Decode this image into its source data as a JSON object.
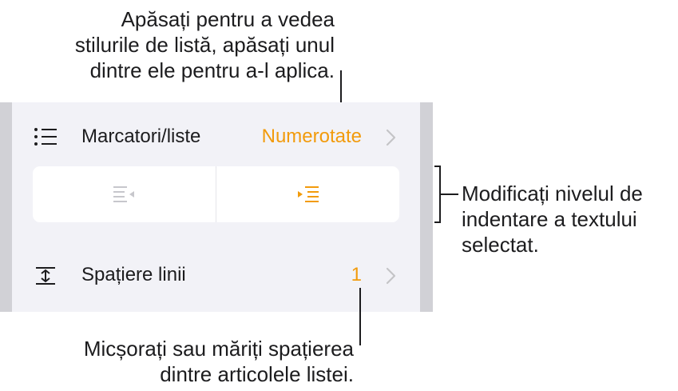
{
  "callouts": {
    "top": {
      "line1": "Apăsați pentru a vedea",
      "line2": "stilurile de listă, apăsați unul",
      "line3": "dintre ele pentru a-l aplica."
    },
    "right": {
      "line1": "Modificați nivelul de",
      "line2": "indentare a textului",
      "line3": "selectat."
    },
    "bottom": {
      "line1": "Micșorați sau măriți spațierea",
      "line2": "dintre articolele listei."
    }
  },
  "panel": {
    "bullets_row": {
      "icon": "list-icon",
      "label": "Marcatori/liste",
      "value": "Numerotate"
    },
    "indent_control": {
      "outdent_icon": "decrease-indent-icon",
      "indent_icon": "increase-indent-icon",
      "outdent_enabled": false,
      "indent_enabled": true
    },
    "spacing_row": {
      "icon": "line-spacing-icon",
      "label": "Spațiere linii",
      "value": "1"
    }
  },
  "colors": {
    "accent": "#f29b0c",
    "panel_background": "#f2f2f7",
    "panel_edge": "#d1d1d6",
    "disabled_icon": "#c7c7cc",
    "chevron": "#c4c4c7"
  }
}
